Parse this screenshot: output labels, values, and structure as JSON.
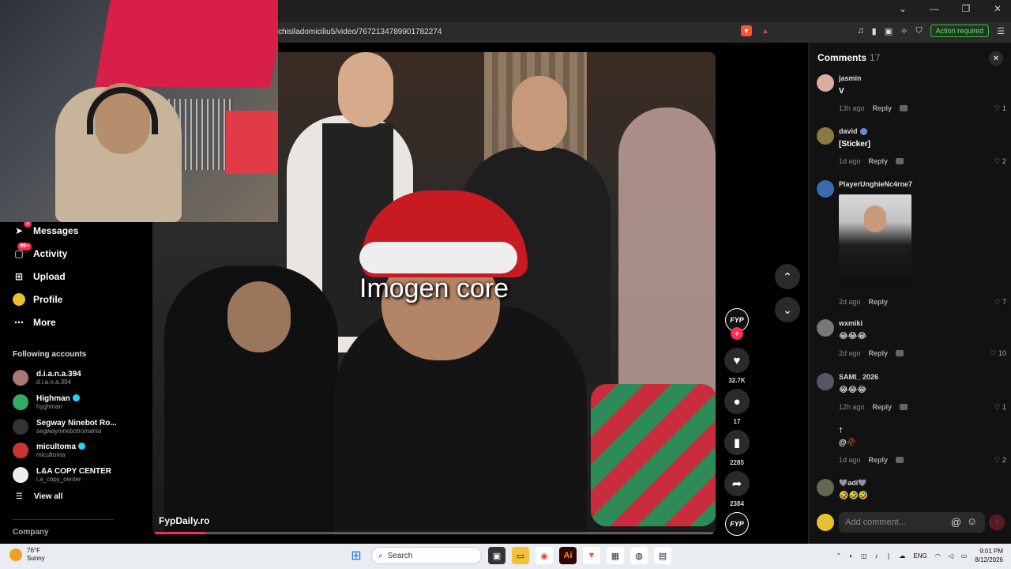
{
  "browser": {
    "url": "chisiladomiciliu5/video/7672134789901782274",
    "action_required": "Action required",
    "window_controls": [
      "⌄",
      "—",
      "❐",
      "✕"
    ]
  },
  "sidebar": {
    "nav": [
      {
        "label": "Messages",
        "badge": "3",
        "icon": "paper-plane-icon"
      },
      {
        "label": "Activity",
        "badge": "99+",
        "icon": "inbox-icon"
      },
      {
        "label": "Upload",
        "badge": "",
        "icon": "plus-square-icon"
      },
      {
        "label": "Profile",
        "badge": "",
        "icon": "profile-avatar-icon"
      },
      {
        "label": "More",
        "badge": "",
        "icon": "more-dots-icon"
      }
    ],
    "following_title": "Following accounts",
    "following": [
      {
        "name": "d.i.a.n.a.394",
        "handle": "d.i.a.n.a.394",
        "verified": false,
        "color": "#a77"
      },
      {
        "name": "Highman",
        "handle": "hyghman",
        "verified": true,
        "color": "#3a6"
      },
      {
        "name": "Segway Ninebot Ro...",
        "handle": "segwayninebotromania",
        "verified": false,
        "color": "#333"
      },
      {
        "name": "micultoma",
        "handle": "micultoma",
        "verified": true,
        "color": "#c33"
      },
      {
        "name": "L&A COPY CENTER",
        "handle": "l.a_copy_center",
        "verified": false,
        "color": "#eee"
      }
    ],
    "view_all": "View all",
    "company": "Company"
  },
  "video": {
    "caption": "Imogen core",
    "watermark": "FypDaily.ro",
    "progress": 0.09
  },
  "actions": {
    "creator_logo": "FYP",
    "likes": "32.7K",
    "comments": "17",
    "saves": "2285",
    "shares": "2384"
  },
  "comments": {
    "title": "Comments",
    "count": "17",
    "input_placeholder": "Add comment...",
    "reply_label": "Reply",
    "items": [
      {
        "user": "jasmin",
        "text": "V",
        "time": "13h ago",
        "likes": "1",
        "color": "#d9b0a0"
      },
      {
        "user": "david",
        "text": "[Sticker]",
        "time": "1d ago",
        "likes": "2",
        "color": "#8a7a40"
      },
      {
        "user": "PlayerUnghieNc4rne7",
        "text": "",
        "time": "2d ago",
        "likes": "7",
        "color": "#3a6ab0"
      },
      {
        "user": "wxmiki",
        "text": "😂😂😂",
        "time": "2d ago",
        "likes": "10",
        "color": "#777"
      },
      {
        "user": "SAMI_ 2026",
        "text": "😂😂😂",
        "time": "12h ago",
        "likes": "1",
        "color": "#556"
      },
      {
        "user": "†",
        "text": "@🥀",
        "time": "1d ago",
        "likes": "2",
        "color": "#121212"
      },
      {
        "user": "🩶adi🩶",
        "text": "🤣🤣🤣",
        "time": "",
        "likes": "",
        "color": "#665"
      }
    ]
  },
  "taskbar": {
    "temp": "76°F",
    "condition": "Sunny",
    "search": "Search",
    "lang": "ENG",
    "time": "9:01 PM",
    "date": "8/12/2026"
  }
}
